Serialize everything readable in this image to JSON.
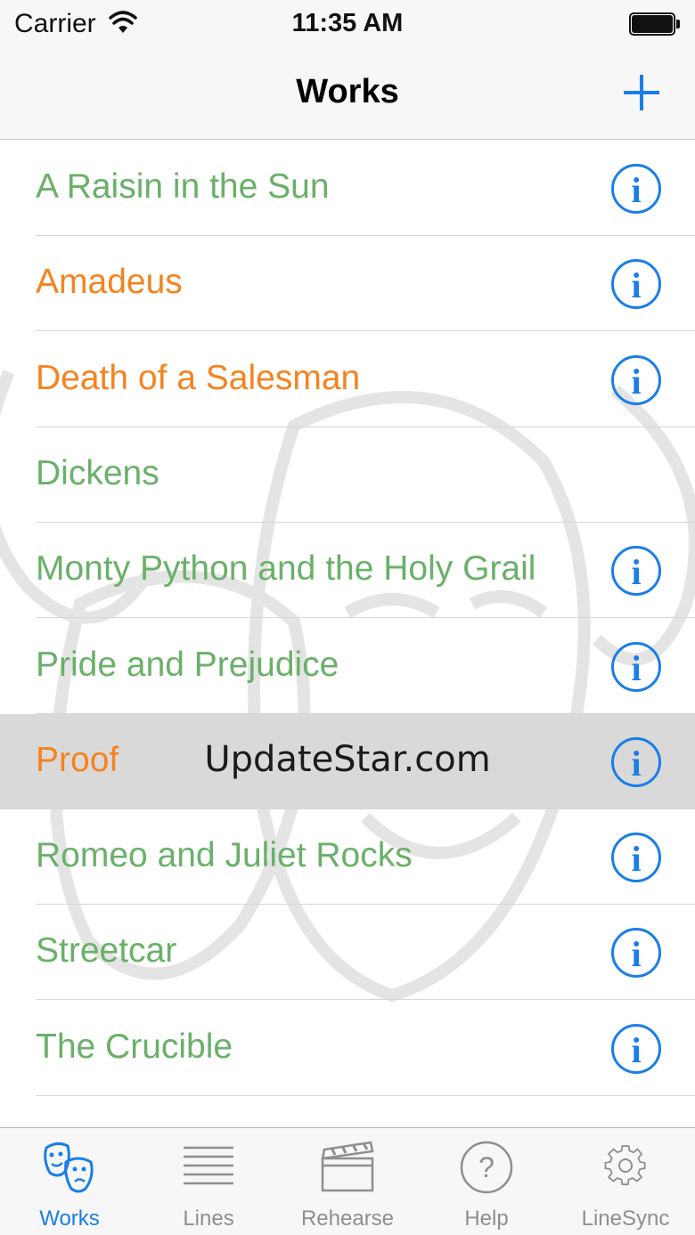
{
  "status_bar": {
    "carrier": "Carrier",
    "time": "11:35 AM",
    "battery_level": 1.0
  },
  "nav": {
    "title": "Works",
    "add_icon": "plus-icon"
  },
  "colors": {
    "accent": "#1a7ee8",
    "title_green": "#6ab06a",
    "title_orange": "#f5831f",
    "selected_row": "#d9d9d9"
  },
  "works": [
    {
      "title": "A Raisin in the Sun",
      "color": "#6ab06a",
      "has_info": true,
      "selected": false
    },
    {
      "title": "Amadeus",
      "color": "#f5831f",
      "has_info": true,
      "selected": false
    },
    {
      "title": "Death of a Salesman",
      "color": "#f5831f",
      "has_info": true,
      "selected": false
    },
    {
      "title": "Dickens",
      "color": "#6ab06a",
      "has_info": false,
      "selected": false
    },
    {
      "title": "Monty Python and the Holy Grail",
      "color": "#6ab06a",
      "has_info": true,
      "selected": false
    },
    {
      "title": "Pride and Prejudice",
      "color": "#6ab06a",
      "has_info": true,
      "selected": false
    },
    {
      "title": "Proof",
      "color": "#f5831f",
      "has_info": true,
      "selected": true
    },
    {
      "title": "Romeo and Juliet Rocks",
      "color": "#6ab06a",
      "has_info": true,
      "selected": false
    },
    {
      "title": "Streetcar",
      "color": "#6ab06a",
      "has_info": true,
      "selected": false
    },
    {
      "title": "The Crucible",
      "color": "#6ab06a",
      "has_info": true,
      "selected": false
    }
  ],
  "info_glyph": "i",
  "watermark": "UpdateStar.com",
  "tabs": [
    {
      "label": "Works",
      "icon": "theater-masks-icon",
      "active": true
    },
    {
      "label": "Lines",
      "icon": "lines-icon",
      "active": false
    },
    {
      "label": "Rehearse",
      "icon": "clapperboard-icon",
      "active": false
    },
    {
      "label": "Help",
      "icon": "help-icon",
      "active": false
    },
    {
      "label": "LineSync",
      "icon": "gear-icon",
      "active": false
    }
  ]
}
